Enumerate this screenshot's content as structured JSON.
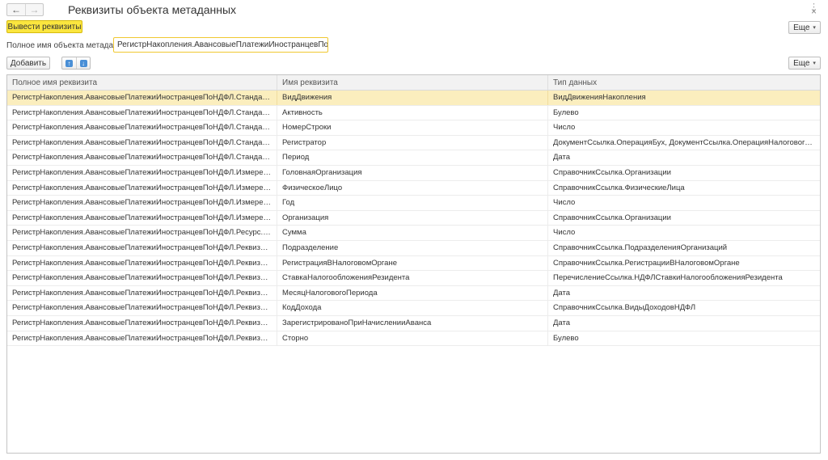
{
  "window": {
    "title": "Реквизиты объекта метаданных",
    "back_icon": "←",
    "forward_icon": "→",
    "menu_icon": "⋮",
    "close_icon": "×"
  },
  "toolbar": {
    "output_button": "Вывести реквизиты",
    "more_button": "Еще",
    "more_caret": "▾"
  },
  "field": {
    "label": "Полное имя объекта метаданных:",
    "value": "РегистрНакопления.АвансовыеПлатежиИностранцевПоНДФЛ"
  },
  "table_toolbar": {
    "add_button": "Добавить",
    "move_up_icon": "↑",
    "move_down_icon": "↓",
    "more_button": "Еще",
    "more_caret": "▾"
  },
  "table": {
    "columns": [
      "Полное имя реквизита",
      "Имя реквизита",
      "Тип данных"
    ],
    "selected_row": 0,
    "rows": [
      [
        "РегистрНакопления.АвансовыеПлатежиИностранцевПоНДФЛ.СтандартныйРеквиз...",
        "ВидДвижения",
        "ВидДвиженияНакопления"
      ],
      [
        "РегистрНакопления.АвансовыеПлатежиИностранцевПоНДФЛ.СтандартныйРеквиз...",
        "Активность",
        "Булево"
      ],
      [
        "РегистрНакопления.АвансовыеПлатежиИностранцевПоНДФЛ.СтандартныйРеквиз...",
        "НомерСтроки",
        "Число"
      ],
      [
        "РегистрНакопления.АвансовыеПлатежиИностранцевПоНДФЛ.СтандартныйРеквиз...",
        "Регистратор",
        "ДокументСсылка.ОперацияБух, ДокументСсылка.ОперацияНалоговогоУчетаПоН..."
      ],
      [
        "РегистрНакопления.АвансовыеПлатежиИностранцевПоНДФЛ.СтандартныйРеквиз...",
        "Период",
        "Дата"
      ],
      [
        "РегистрНакопления.АвансовыеПлатежиИностранцевПоНДФЛ.Измерение.Головна...",
        "ГоловнаяОрганизация",
        "СправочникСсылка.Организации"
      ],
      [
        "РегистрНакопления.АвансовыеПлатежиИностранцевПоНДФЛ.Измерение.Физиче...",
        "ФизическоеЛицо",
        "СправочникСсылка.ФизическиеЛица"
      ],
      [
        "РегистрНакопления.АвансовыеПлатежиИностранцевПоНДФЛ.Измерение.Год",
        "Год",
        "Число"
      ],
      [
        "РегистрНакопления.АвансовыеПлатежиИностранцевПоНДФЛ.Измерение.Организ...",
        "Организация",
        "СправочникСсылка.Организации"
      ],
      [
        "РегистрНакопления.АвансовыеПлатежиИностранцевПоНДФЛ.Ресурс.Сумма",
        "Сумма",
        "Число"
      ],
      [
        "РегистрНакопления.АвансовыеПлатежиИностранцевПоНДФЛ.Реквизит.Подразде...",
        "Подразделение",
        "СправочникСсылка.ПодразделенияОрганизаций"
      ],
      [
        "РегистрНакопления.АвансовыеПлатежиИностранцевПоНДФЛ.Реквизит.Регистрац...",
        "РегистрацияВНалоговомОргане",
        "СправочникСсылка.РегистрацииВНалоговомОргане"
      ],
      [
        "РегистрНакопления.АвансовыеПлатежиИностранцевПоНДФЛ.Реквизит.СтавкаНа...",
        "СтавкаНалогообложенияРезидента",
        "ПеречислениеСсылка.НДФЛСтавкиНалогообложенияРезидента"
      ],
      [
        "РегистрНакопления.АвансовыеПлатежиИностранцевПоНДФЛ.Реквизит.МесяцНал...",
        "МесяцНалоговогоПериода",
        "Дата"
      ],
      [
        "РегистрНакопления.АвансовыеПлатежиИностранцевПоНДФЛ.Реквизит.КодДохода",
        "КодДохода",
        "СправочникСсылка.ВидыДоходовНДФЛ"
      ],
      [
        "РегистрНакопления.АвансовыеПлатежиИностранцевПоНДФЛ.Реквизит.Зарегистр...",
        "ЗарегистрированоПриНачисленииАванса",
        "Дата"
      ],
      [
        "РегистрНакопления.АвансовыеПлатежиИностранцевПоНДФЛ.Реквизит.Сторно",
        "Сторно",
        "Булево"
      ]
    ]
  }
}
